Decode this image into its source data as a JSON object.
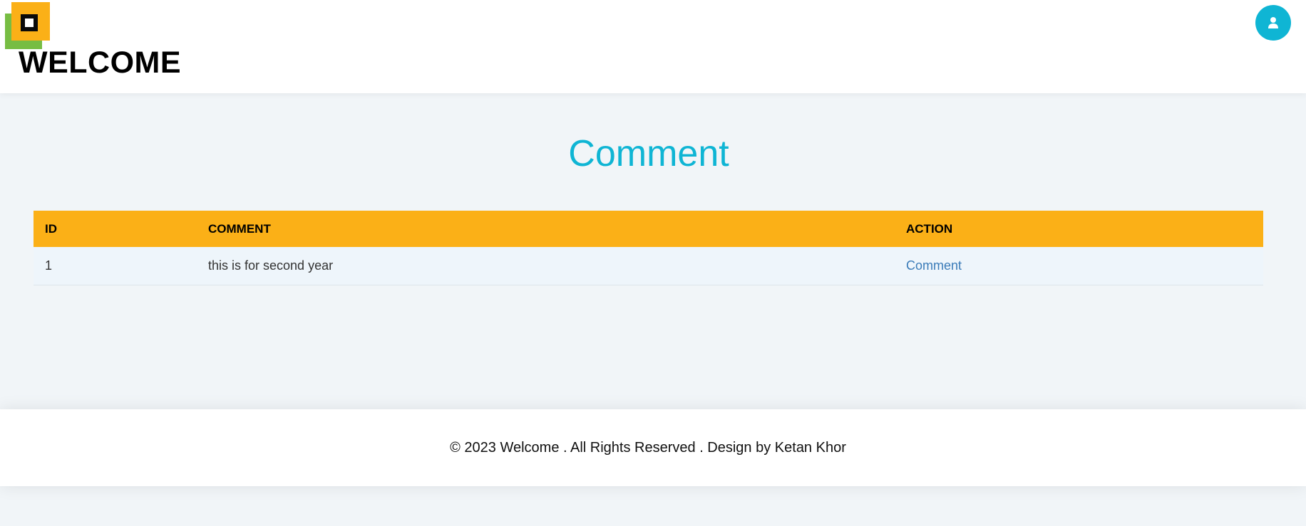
{
  "header": {
    "brand_title": "WELCOME",
    "user_icon": "user-icon"
  },
  "main": {
    "page_title": "Comment",
    "table": {
      "columns": [
        "ID",
        "COMMENT",
        "ACTION"
      ],
      "rows": [
        {
          "id": "1",
          "comment": "this is for second year",
          "action": "Comment"
        }
      ]
    }
  },
  "footer": {
    "text": "© 2023 Welcome . All Rights Reserved . Design by Ketan Khor"
  },
  "colors": {
    "accent_cyan": "#0fb5d4",
    "header_orange": "#fbb017",
    "logo_green": "#77bd43",
    "link_blue": "#3a7bb8",
    "background": "#f1f5f8"
  }
}
